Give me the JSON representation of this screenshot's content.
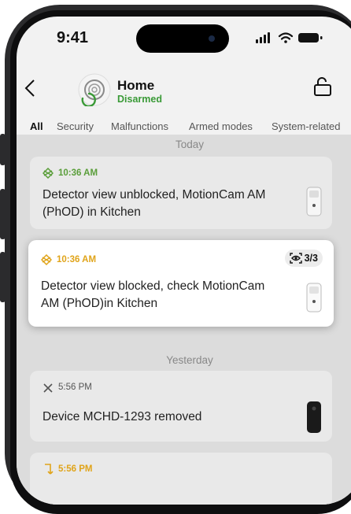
{
  "status_bar": {
    "time": "9:41"
  },
  "header": {
    "title": "Home",
    "status": "Disarmed"
  },
  "tabs": [
    {
      "label": "All",
      "active": true
    },
    {
      "label": "Security"
    },
    {
      "label": "Malfunctions"
    },
    {
      "label": "Armed modes"
    },
    {
      "label": "System-related"
    }
  ],
  "sections": [
    {
      "label": "Today"
    },
    {
      "label": "Yesterday"
    }
  ],
  "events": [
    {
      "time": "10:36 AM",
      "text": "Detector view unblocked, MotionCam AM (PhOD) in Kitchen",
      "icon": "blocked-view-icon",
      "color": "#5a9e3a"
    },
    {
      "time": "10:36 AM",
      "text": "Detector view blocked, check MotionCam AM (PhOD)in Kitchen",
      "icon": "blocked-view-icon",
      "color": "#e0a41a",
      "badge": "3/3"
    },
    {
      "time": "5:56 PM",
      "text": "Device MCHD-1293 removed",
      "icon": "close-icon",
      "color": "#555555"
    },
    {
      "time": "5:56 PM",
      "icon": "device-move-icon",
      "color": "#e0a41a"
    }
  ],
  "colors": {
    "accent_green": "#3a9a37",
    "warning": "#e0a41a",
    "background": "#dcdcdc"
  }
}
